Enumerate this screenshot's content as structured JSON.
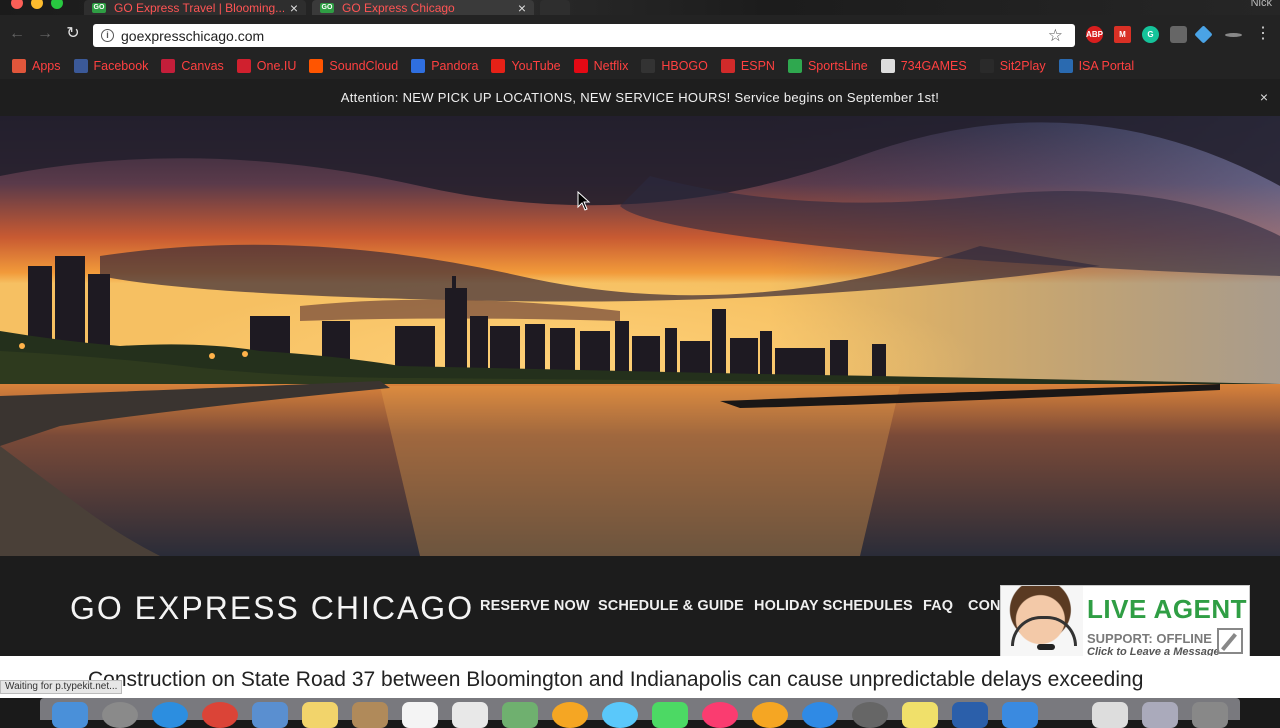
{
  "browser": {
    "tabs": [
      {
        "title": "GO Express Travel | Blooming...",
        "favicon": "GO"
      },
      {
        "title": "GO Express Chicago",
        "favicon": "GO"
      }
    ],
    "profile": "Nick",
    "url": "goexpresschicago.com",
    "bookmarks": [
      {
        "label": "Apps",
        "icon": "apps-grid-icon",
        "color": "#e0563b"
      },
      {
        "label": "Facebook",
        "icon": "facebook-icon",
        "color": "#3b5998"
      },
      {
        "label": "Canvas",
        "icon": "canvas-icon",
        "color": "#c41e3a"
      },
      {
        "label": "One.IU",
        "icon": "one-iu-icon",
        "color": "#d0202e"
      },
      {
        "label": "SoundCloud",
        "icon": "soundcloud-icon",
        "color": "#ff5500"
      },
      {
        "label": "Pandora",
        "icon": "pandora-icon",
        "color": "#2f6fe0"
      },
      {
        "label": "YouTube",
        "icon": "youtube-icon",
        "color": "#e62117"
      },
      {
        "label": "Netflix",
        "icon": "netflix-icon",
        "color": "#e50914"
      },
      {
        "label": "HBOGO",
        "icon": "hbogo-icon",
        "color": "#333333"
      },
      {
        "label": "ESPN",
        "icon": "espn-icon",
        "color": "#d12a2a"
      },
      {
        "label": "SportsLine",
        "icon": "sportsline-icon",
        "color": "#2fa84f"
      },
      {
        "label": "734GAMES",
        "icon": "page-icon",
        "color": "#dddddd"
      },
      {
        "label": "Sit2Play",
        "icon": "sit2play-icon",
        "color": "#2a2a2a"
      },
      {
        "label": "ISA Portal",
        "icon": "isa-icon",
        "color": "#2a6ab0"
      }
    ],
    "extensions": [
      {
        "name": "adblock-icon",
        "text": "ABP",
        "color": "#d81e1e"
      },
      {
        "name": "gmail-icon",
        "text": "M",
        "color": "#d93025"
      },
      {
        "name": "grammarly-icon",
        "text": "G",
        "color": "#15c39a"
      },
      {
        "name": "extension-icon",
        "text": "",
        "color": "#666666"
      },
      {
        "name": "diamond-icon",
        "text": "",
        "color": "#4aa3e6"
      },
      {
        "name": "pen-icon",
        "text": "",
        "color": "#888888"
      }
    ],
    "status_text": "Waiting for p.typekit.net..."
  },
  "site": {
    "attention": "Attention:  NEW PICK UP LOCATIONS, NEW SERVICE HOURS!  Service begins on September 1st!",
    "attention_close": "×",
    "brand": "GO EXPRESS CHICAGO",
    "nav": [
      "RESERVE NOW",
      "SCHEDULE & GUIDE",
      "HOLIDAY SCHEDULES",
      "FAQ",
      "CON"
    ],
    "ticker": "Construction on State Road 37 between Bloomington and Indianapolis can cause unpredictable delays exceeding"
  },
  "live_agent": {
    "title": "LIVE AGENT",
    "status": "SUPPORT: OFFLINE",
    "cta": "Click to Leave a Message"
  }
}
